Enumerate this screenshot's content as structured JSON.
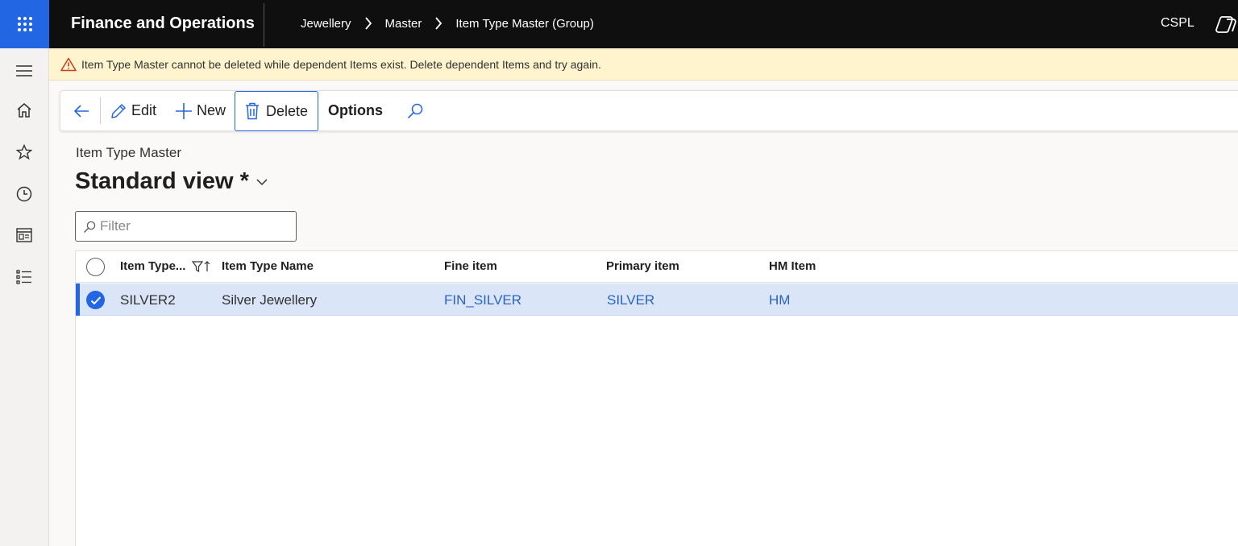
{
  "app": {
    "title": "Finance and Operations",
    "company": "CSPL"
  },
  "breadcrumb": [
    "Jewellery",
    "Master",
    "Item Type Master (Group)"
  ],
  "warning": {
    "message": "Item Type Master cannot be deleted while dependent Items exist. Delete dependent Items and try again."
  },
  "actions": {
    "edit": "Edit",
    "new": "New",
    "delete": "Delete",
    "options": "Options"
  },
  "form": {
    "caption": "Item Type Master",
    "view_name": "Standard view *"
  },
  "filter": {
    "placeholder": "Filter",
    "value": ""
  },
  "grid": {
    "columns": [
      "Item Type...",
      "Item Type Name",
      "Fine item",
      "Primary item",
      "HM Item"
    ],
    "rows": [
      {
        "selected": true,
        "item_type": "SILVER2",
        "item_type_name": "Silver Jewellery",
        "fine_item": "FIN_SILVER",
        "primary_item": "SILVER",
        "hm_item": "HM"
      }
    ]
  },
  "colors": {
    "accent": "#2266e3",
    "topbar": "#0f0f0f",
    "warning_bg": "#fff4ce",
    "selected_row": "#dae6f7",
    "link": "#2a63c4"
  },
  "icons": {
    "waffle": "waffle-icon",
    "nav": [
      "hamburger-icon",
      "home-icon",
      "star-icon",
      "clock-icon",
      "workspace-icon",
      "list-icon"
    ],
    "warning": "warning-triangle-icon",
    "back": "back-arrow-icon",
    "edit": "pencil-icon",
    "new": "plus-icon",
    "delete": "trash-icon",
    "search": "search-icon",
    "copilot": "copilot-icon"
  }
}
